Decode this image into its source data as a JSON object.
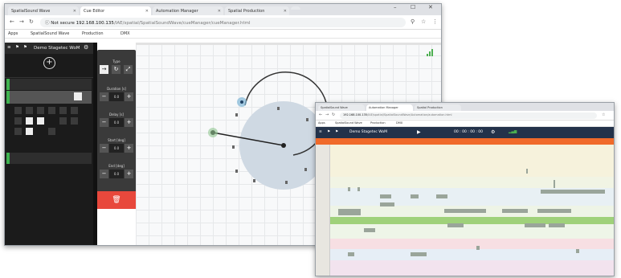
{
  "window1": {
    "tabs": [
      {
        "label": "SpatialSound Wave"
      },
      {
        "label": "Cue Editor"
      },
      {
        "label": "Automation Manager"
      },
      {
        "label": "Spatial Production"
      }
    ],
    "address": {
      "security": "Not secure",
      "host": "192.168.100.135",
      "path": "/IAE/spatial/SpatialSoundWave/cueManager/cueManager.html"
    },
    "bookmarks": [
      {
        "label": "Apps"
      },
      {
        "label": "SpatialSound Wave"
      },
      {
        "label": "Production"
      },
      {
        "label": "DMX"
      }
    ],
    "app": {
      "title": "Demo Stagetec WoM",
      "add_icon": "plus-circle-icon",
      "controls": {
        "sections": [
          {
            "label": "Type"
          },
          {
            "label": "Duration [s]",
            "value": "0.0"
          },
          {
            "label": "Delay [s]",
            "value": "0.0"
          },
          {
            "label": "Start [deg]",
            "value": "0.0"
          },
          {
            "label": "End [deg]",
            "value": "0.0"
          }
        ],
        "delete_icon": "trash-icon",
        "delete_color": "#e8483c"
      }
    }
  },
  "window2": {
    "tabs": [
      {
        "label": "SpatialSound Wave"
      },
      {
        "label": "Automation Manager"
      },
      {
        "label": "Spatial Production"
      }
    ],
    "address": {
      "host": "192.168.100.135",
      "path": "/IAE/spatial/SpatialSoundWave/Automation/automation.html"
    },
    "bookmarks": [
      {
        "label": "Apps"
      },
      {
        "label": "SpatialSound Wave"
      },
      {
        "label": "Production"
      },
      {
        "label": "DMX"
      }
    ],
    "app": {
      "title": "Demo Stagetec WoM",
      "timecode": "00 : 00 : 00 : 00",
      "toolbar_color": "#23324a",
      "timeline_color": "#f06a2a"
    }
  }
}
